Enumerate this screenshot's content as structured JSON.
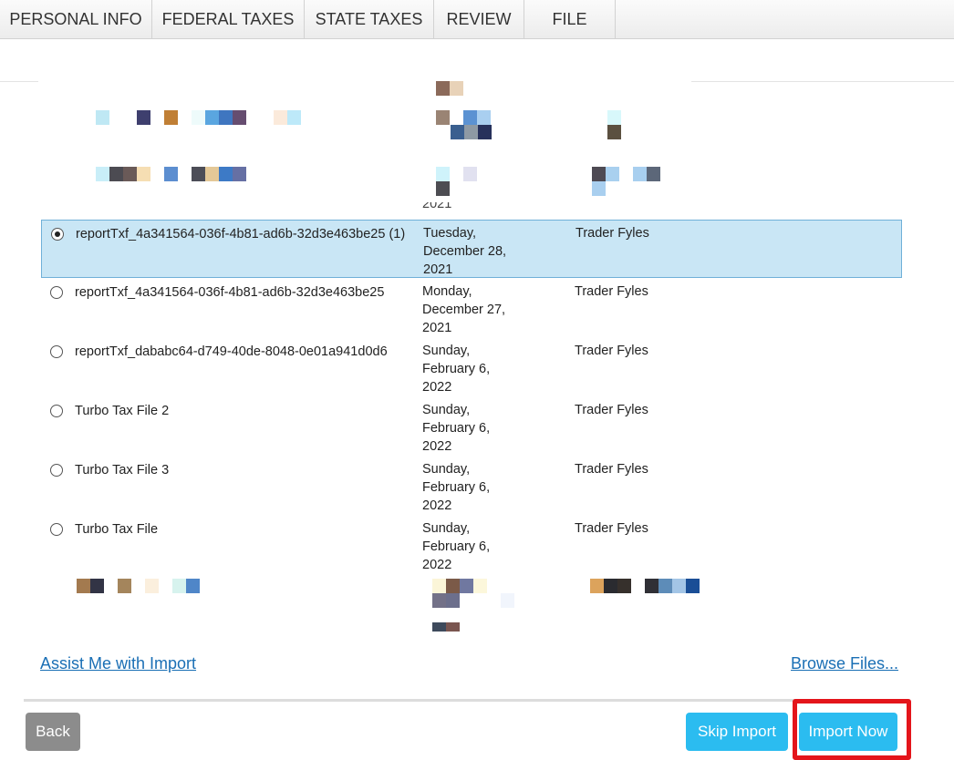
{
  "tabs": [
    {
      "label": "PERSONAL INFO"
    },
    {
      "label": "FEDERAL TAXES"
    },
    {
      "label": "STATE TAXES"
    },
    {
      "label": "REVIEW"
    },
    {
      "label": "FILE"
    }
  ],
  "files": [
    {
      "name": "reportTxf_4a341564-036f-4b81-ad6b-32d3e463be25 (1)",
      "date": "Tuesday, December 28, 2021",
      "source": "Trader Fyles",
      "selected": true
    },
    {
      "name": "reportTxf_4a341564-036f-4b81-ad6b-32d3e463be25",
      "date": "Monday, December 27, 2021",
      "source": "Trader Fyles",
      "selected": false
    },
    {
      "name": "reportTxf_dababc64-d749-40de-8048-0e01a941d0d6",
      "date": "Sunday, February 6, 2022",
      "source": "Trader Fyles",
      "selected": false
    },
    {
      "name": "Turbo Tax File 2",
      "date": "Sunday, February 6, 2022",
      "source": "Trader Fyles",
      "selected": false
    },
    {
      "name": "Turbo Tax File 3",
      "date": "Sunday, February 6, 2022",
      "source": "Trader Fyles",
      "selected": false
    },
    {
      "name": "Turbo Tax File",
      "date": "Sunday, February 6, 2022",
      "source": "Trader Fyles",
      "selected": false
    }
  ],
  "cut_off_text": "2021",
  "links": {
    "assist": "Assist Me with Import",
    "browse": "Browse Files..."
  },
  "buttons": {
    "back": "Back",
    "skip": "Skip Import",
    "import": "Import Now"
  },
  "colors": {
    "selected_row": "#c9e6f5",
    "primary_button": "#2bbcf0",
    "back_button": "#8c8c8c",
    "link": "#1a6fb5",
    "highlight": "#e4151b"
  }
}
